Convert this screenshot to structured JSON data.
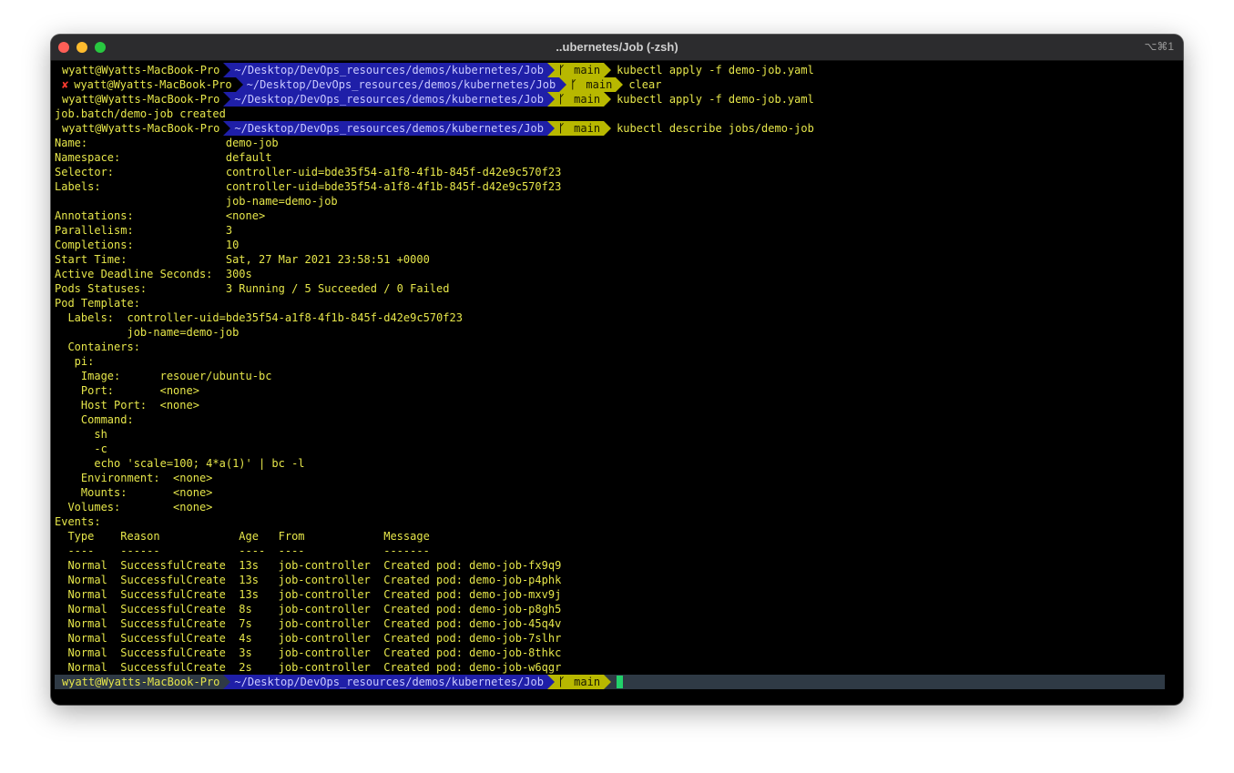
{
  "window": {
    "title": "..ubernetes/Job (-zsh)",
    "shortcut": "⌥⌘1"
  },
  "prompt": {
    "user": "wyatt@Wyatts-MacBook-Pro",
    "dir": "~/Desktop/DevOps_resources/demos/kubernetes/Job",
    "branch": "main",
    "branch_icon": "ᚴ",
    "error_mark": "✘"
  },
  "history": [
    {
      "error": false,
      "command": "kubectl apply -f demo-job.yaml"
    },
    {
      "error": true,
      "command": "clear"
    },
    {
      "error": false,
      "command": "kubectl apply -f demo-job.yaml"
    }
  ],
  "created_output": "job.batch/demo-job created",
  "describe_command": "kubectl describe jobs/demo-job",
  "describe_lines": [
    "Name:                     demo-job",
    "Namespace:                default",
    "Selector:                 controller-uid=bde35f54-a1f8-4f1b-845f-d42e9c570f23",
    "Labels:                   controller-uid=bde35f54-a1f8-4f1b-845f-d42e9c570f23",
    "                          job-name=demo-job",
    "Annotations:              <none>",
    "Parallelism:              3",
    "Completions:              10",
    "Start Time:               Sat, 27 Mar 2021 23:58:51 +0000",
    "Active Deadline Seconds:  300s",
    "Pods Statuses:            3 Running / 5 Succeeded / 0 Failed",
    "Pod Template:",
    "  Labels:  controller-uid=bde35f54-a1f8-4f1b-845f-d42e9c570f23",
    "           job-name=demo-job",
    "  Containers:",
    "   pi:",
    "    Image:      resouer/ubuntu-bc",
    "    Port:       <none>",
    "    Host Port:  <none>",
    "    Command:",
    "      sh",
    "      -c",
    "      echo 'scale=100; 4*a(1)' | bc -l",
    "    Environment:  <none>",
    "    Mounts:       <none>",
    "  Volumes:        <none>",
    "Events:",
    "  Type    Reason            Age   From            Message",
    "  ----    ------            ----  ----            -------",
    "  Normal  SuccessfulCreate  13s   job-controller  Created pod: demo-job-fx9q9",
    "  Normal  SuccessfulCreate  13s   job-controller  Created pod: demo-job-p4phk",
    "  Normal  SuccessfulCreate  13s   job-controller  Created pod: demo-job-mxv9j",
    "  Normal  SuccessfulCreate  8s    job-controller  Created pod: demo-job-p8gh5",
    "  Normal  SuccessfulCreate  7s    job-controller  Created pod: demo-job-45q4v",
    "  Normal  SuccessfulCreate  4s    job-controller  Created pod: demo-job-7slhr",
    "  Normal  SuccessfulCreate  3s    job-controller  Created pod: demo-job-8thkc",
    "  Normal  SuccessfulCreate  2s    job-controller  Created pod: demo-job-w6qgr"
  ],
  "colors": {
    "text": "#e6e64a",
    "dir_bg": "#1f1fa8",
    "git_bg": "#b8b800",
    "cursor": "#22d16a",
    "error": "#ff3b30"
  }
}
